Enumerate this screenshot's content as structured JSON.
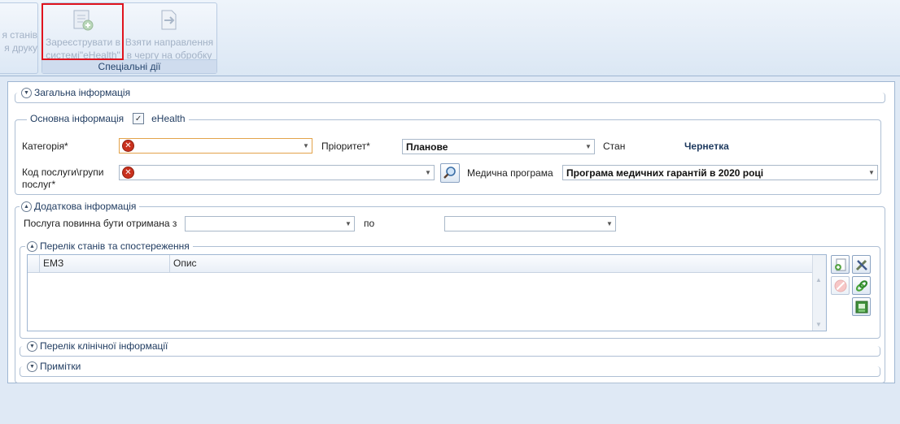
{
  "ribbon": {
    "partial_button": {
      "line1": "я станів",
      "line2": "я друку"
    },
    "register_button": {
      "line1": "Зареєструвати в",
      "line2": "системі\"eHealth\""
    },
    "take_button": {
      "line1": "Взяти направлення",
      "line2": "в чергу на обробку"
    },
    "group_caption": "Спеціальні дії"
  },
  "sections": {
    "general": "Загальна інформація",
    "basic": "Основна інформація",
    "ehealth_label": "eHealth",
    "ehealth_checked": true,
    "additional": "Додаткова інформація",
    "states": "Перелік станів та спостереження",
    "clinical": "Перелік клінічної інформації",
    "notes": "Примітки"
  },
  "form": {
    "category_label": "Категорія*",
    "category_value": "",
    "priority_label": "Пріоритет*",
    "priority_value": "Планове",
    "state_label": "Стан",
    "state_value": "Чернетка",
    "service_label_line1": "Код послуги\\групи",
    "service_label_line2": "послуг*",
    "service_value": "",
    "program_label": "Медична програма",
    "program_value": "Програма медичних гарантій в 2020 році",
    "date_from_label": "Послуга повинна бути отримана з",
    "date_from_value": "",
    "date_to_label": "по",
    "date_to_value": ""
  },
  "grid": {
    "columns": [
      "ЕМЗ",
      "Опис"
    ],
    "rows": []
  },
  "icons": {
    "error": "error-icon",
    "search": "search-icon"
  }
}
